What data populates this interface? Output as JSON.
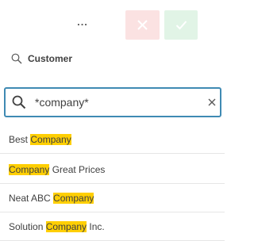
{
  "toolbar": {
    "more_label": "...",
    "cancel_icon": "close-icon",
    "confirm_icon": "checkmark-icon",
    "cancel_color": "#f05a5a",
    "confirm_color": "#3fb34f"
  },
  "field": {
    "icon": "search-icon",
    "title": "Customer"
  },
  "search": {
    "icon": "search-icon",
    "value": "*company*",
    "clear_icon": "close-icon"
  },
  "highlight_color": "#ffcf03",
  "results": [
    {
      "pre": "Best ",
      "match": "Company",
      "post": ""
    },
    {
      "pre": "",
      "match": "Company",
      "post": " Great Prices"
    },
    {
      "pre": "Neat ABC ",
      "match": "Company",
      "post": ""
    },
    {
      "pre": "Solution ",
      "match": "Company",
      "post": " Inc."
    }
  ]
}
